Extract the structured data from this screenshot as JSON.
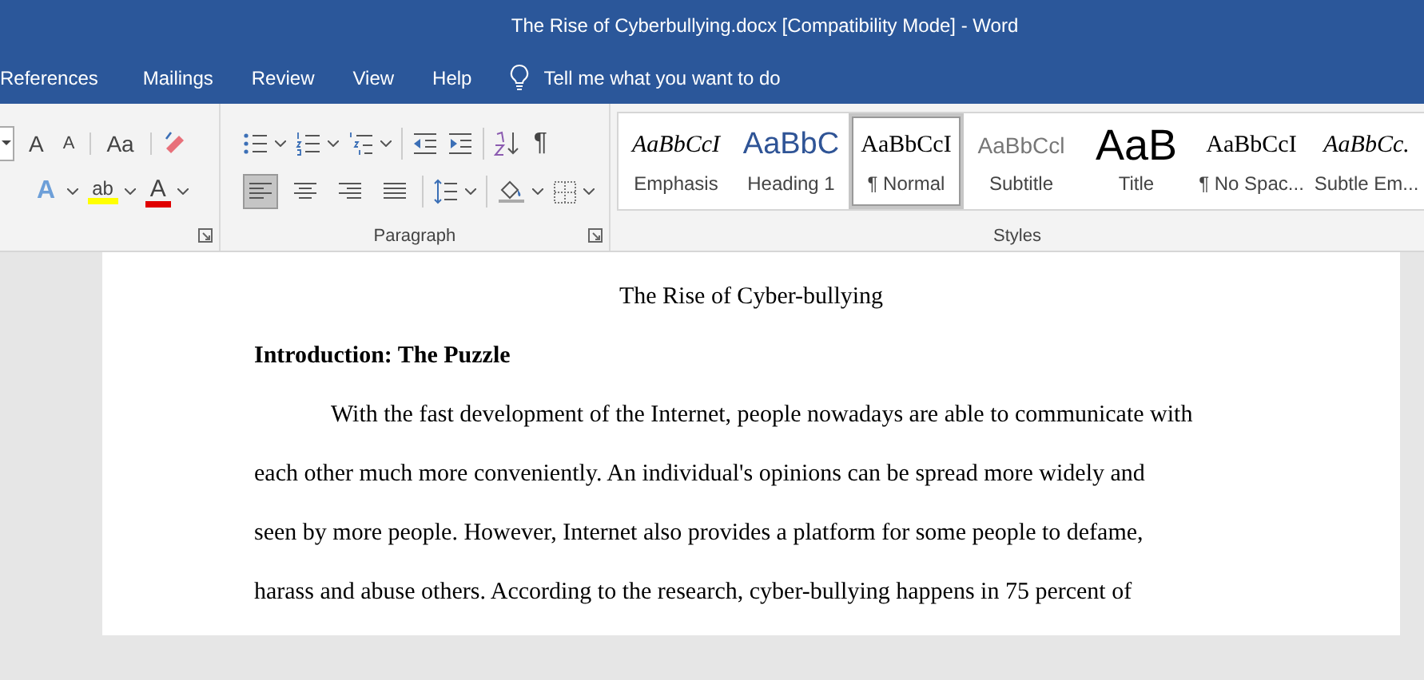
{
  "window": {
    "title": "The Rise of Cyberbullying.docx [Compatibility Mode]  -  Word"
  },
  "menu_tabs": [
    {
      "label": "References",
      "selected": false
    },
    {
      "label": "Mailings",
      "selected": false
    },
    {
      "label": "Review",
      "selected": false
    },
    {
      "label": "View",
      "selected": false
    },
    {
      "label": "Help",
      "selected": false
    }
  ],
  "tell_me": {
    "placeholder": "Tell me what you want to do"
  },
  "font_group": {
    "row_1": [
      {
        "kind": "grow",
        "label": "A"
      },
      {
        "kind": "shrink",
        "label": "A"
      },
      {
        "kind": "case",
        "label": "Aa"
      },
      {
        "kind": "clear"
      }
    ],
    "row_2": [
      {
        "kind": "effects",
        "label": "A"
      },
      {
        "kind": "highlight",
        "label": "ab"
      },
      {
        "kind": "fontcolor",
        "label": "A"
      }
    ]
  },
  "paragraph_group": {
    "label": "Paragraph",
    "row_1": [
      {
        "kind": "bullets"
      },
      {
        "kind": "numbering"
      },
      {
        "kind": "multilevel"
      },
      {
        "kind": "outdent"
      },
      {
        "kind": "indent"
      },
      {
        "kind": "sort"
      },
      {
        "kind": "pilcrow",
        "label": "¶"
      }
    ],
    "alignment": [
      {
        "kind": "left",
        "selected": true
      },
      {
        "kind": "center",
        "selected": false
      },
      {
        "kind": "right",
        "selected": false
      },
      {
        "kind": "justify",
        "selected": false
      }
    ],
    "row_2": [
      {
        "kind": "spacing"
      },
      {
        "kind": "shading"
      },
      {
        "kind": "borders"
      }
    ]
  },
  "styles_group": {
    "label": "Styles",
    "items": [
      {
        "sample": "AaBbCcI",
        "label": "Emphasis",
        "kind": "emphasis",
        "selected": false
      },
      {
        "sample": "AaBbC",
        "label": "Heading 1",
        "kind": "heading",
        "selected": false
      },
      {
        "sample": "AaBbCcI",
        "label": "¶ Normal",
        "kind": "normal",
        "selected": true
      },
      {
        "sample": "AaBbCcl",
        "label": "Subtitle",
        "kind": "subtitle",
        "selected": false
      },
      {
        "sample": "AaB",
        "label": "Title",
        "kind": "title",
        "selected": false
      },
      {
        "sample": "AaBbCcI",
        "label": "¶ No Spac...",
        "kind": "normal",
        "selected": false
      },
      {
        "sample": "AaBbCc.",
        "label": "Subtle Em...",
        "kind": "emphasis",
        "selected": false
      }
    ]
  },
  "document": {
    "title": "The Rise of Cyber-bullying",
    "heading": "Introduction: The Puzzle",
    "paragraph": [
      "With the fast development of the Internet, people nowadays are able to communicate with",
      "each other much more conveniently. An individual's opinions can be spread more widely and",
      "seen by more people. However, Internet also provides a platform for some people to defame,",
      "harass and abuse others. According to the research, cyber-bullying happens in 75 percent of"
    ]
  }
}
